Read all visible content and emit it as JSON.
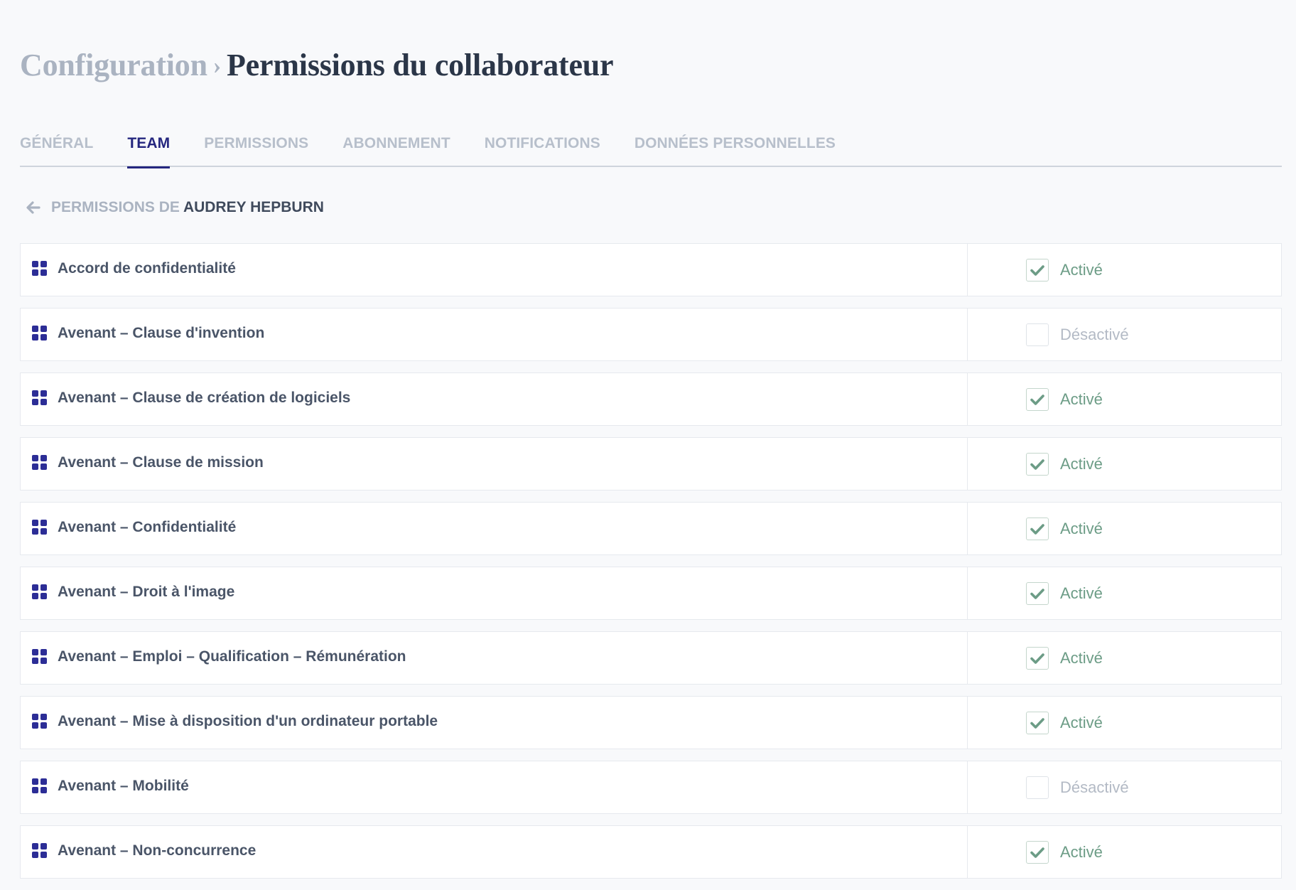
{
  "breadcrumb": {
    "root": "Configuration",
    "separator": "›",
    "current": "Permissions du collaborateur"
  },
  "tabs": [
    {
      "label": "GÉNÉRAL",
      "active": false
    },
    {
      "label": "TEAM",
      "active": true
    },
    {
      "label": "PERMISSIONS",
      "active": false
    },
    {
      "label": "ABONNEMENT",
      "active": false
    },
    {
      "label": "NOTIFICATIONS",
      "active": false
    },
    {
      "label": "DONNÉES PERSONNELLES",
      "active": false
    }
  ],
  "subheader": {
    "prefix": "PERMISSIONS DE",
    "person": "AUDREY HEPBURN",
    "back_icon": "arrow-left-icon"
  },
  "colors": {
    "accent": "#25277f",
    "icon": "#2c2d96",
    "active_green": "#6c9c86",
    "muted": "#aab3c1"
  },
  "status_labels": {
    "on": "Activé",
    "off": "Désactivé"
  },
  "permissions": [
    {
      "label": "Accord de confidentialité",
      "enabled": true
    },
    {
      "label": "Avenant – Clause d'invention",
      "enabled": false
    },
    {
      "label": "Avenant – Clause de création de logiciels",
      "enabled": true
    },
    {
      "label": "Avenant – Clause de mission",
      "enabled": true
    },
    {
      "label": "Avenant – Confidentialité",
      "enabled": true
    },
    {
      "label": "Avenant – Droit à l'image",
      "enabled": true
    },
    {
      "label": "Avenant – Emploi – Qualification – Rémunération",
      "enabled": true
    },
    {
      "label": "Avenant – Mise à disposition d'un ordinateur portable",
      "enabled": true
    },
    {
      "label": "Avenant – Mobilité",
      "enabled": false
    },
    {
      "label": "Avenant – Non-concurrence",
      "enabled": true
    }
  ]
}
